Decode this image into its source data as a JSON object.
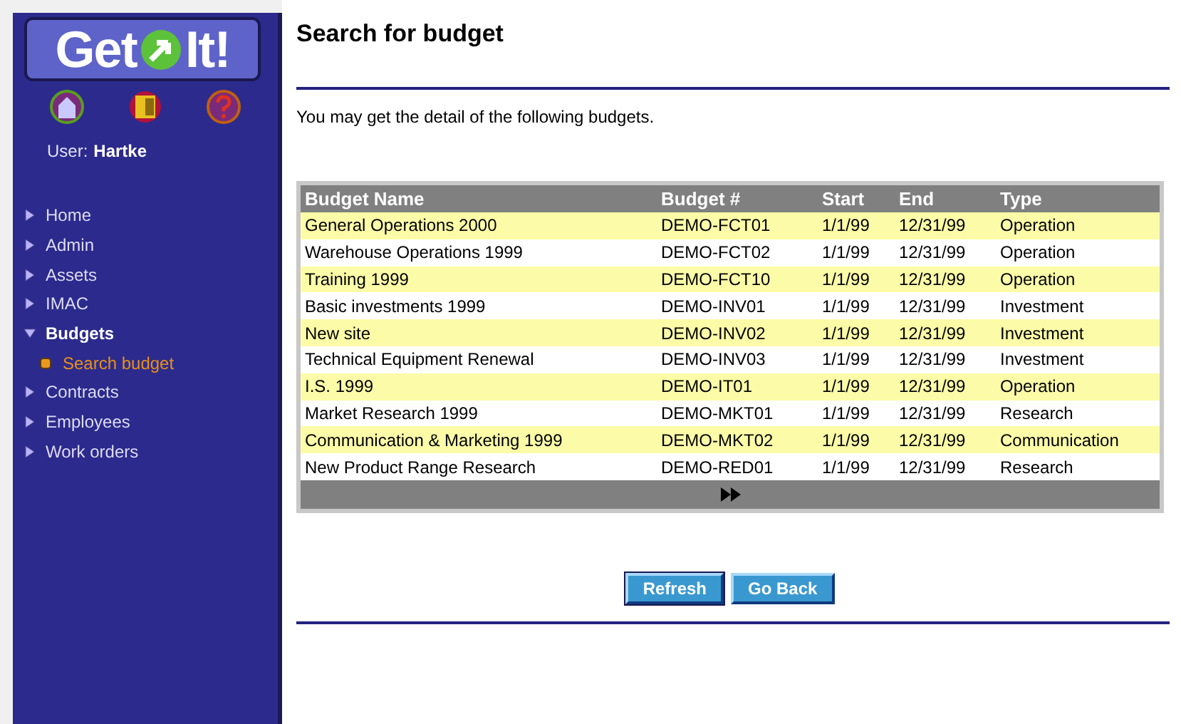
{
  "logo": {
    "left": "Get",
    "right": "It!"
  },
  "user": {
    "label": "User:",
    "name": "Hartke"
  },
  "nav": [
    {
      "label": "Home",
      "expanded": false
    },
    {
      "label": "Admin",
      "expanded": false
    },
    {
      "label": "Assets",
      "expanded": false
    },
    {
      "label": "IMAC",
      "expanded": false
    },
    {
      "label": "Budgets",
      "expanded": true,
      "children": [
        {
          "label": "Search budget",
          "selected": true
        }
      ]
    },
    {
      "label": "Contracts",
      "expanded": false
    },
    {
      "label": "Employees",
      "expanded": false
    },
    {
      "label": "Work orders",
      "expanded": false
    }
  ],
  "page_title": "Search for budget",
  "intro": "You may get the detail of the following budgets.",
  "table": {
    "columns": [
      "Budget Name",
      "Budget #",
      "Start",
      "End",
      "Type"
    ],
    "rows": [
      [
        "General Operations 2000",
        "DEMO-FCT01",
        "1/1/99",
        "12/31/99",
        "Operation"
      ],
      [
        "Warehouse Operations 1999",
        "DEMO-FCT02",
        "1/1/99",
        "12/31/99",
        "Operation"
      ],
      [
        "Training 1999",
        "DEMO-FCT10",
        "1/1/99",
        "12/31/99",
        "Operation"
      ],
      [
        "Basic investments 1999",
        "DEMO-INV01",
        "1/1/99",
        "12/31/99",
        "Investment"
      ],
      [
        "New site",
        "DEMO-INV02",
        "1/1/99",
        "12/31/99",
        "Investment"
      ],
      [
        "Technical Equipment Renewal",
        "DEMO-INV03",
        "1/1/99",
        "12/31/99",
        "Investment"
      ],
      [
        "I.S. 1999",
        "DEMO-IT01",
        "1/1/99",
        "12/31/99",
        "Operation"
      ],
      [
        "Market Research 1999",
        "DEMO-MKT01",
        "1/1/99",
        "12/31/99",
        "Research"
      ],
      [
        "Communication & Marketing 1999",
        "DEMO-MKT02",
        "1/1/99",
        "12/31/99",
        "Communication"
      ],
      [
        "New Product Range Research",
        "DEMO-RED01",
        "1/1/99",
        "12/31/99",
        "Research"
      ]
    ]
  },
  "buttons": [
    {
      "label": "Refresh",
      "focused": true
    },
    {
      "label": "Go Back",
      "focused": false
    }
  ]
}
